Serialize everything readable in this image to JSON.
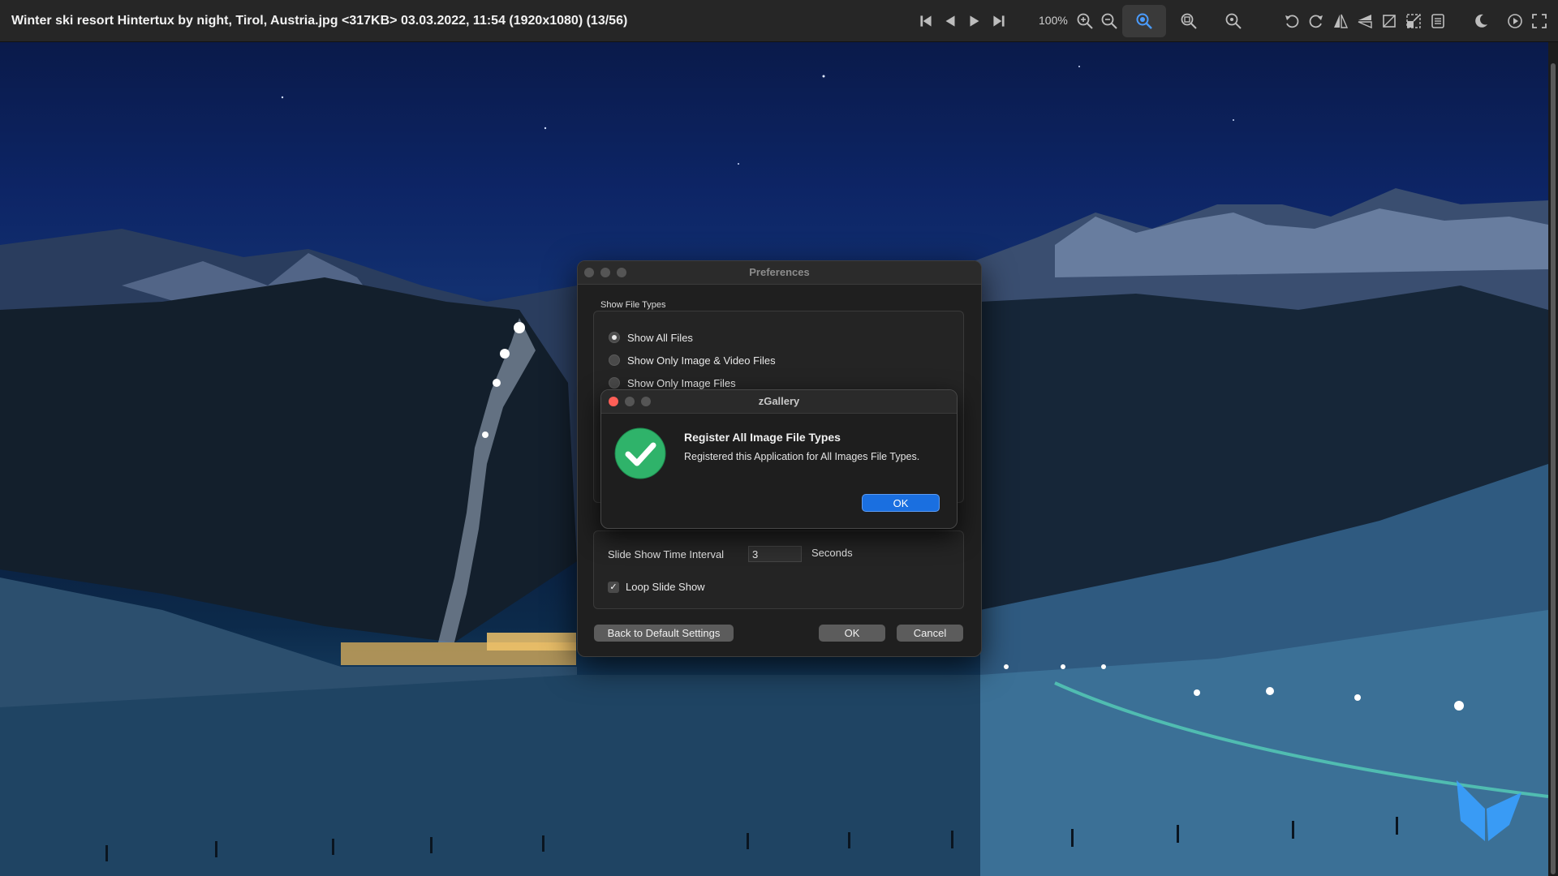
{
  "window": {
    "title": "Winter ski resort Hintertux by night, Tirol, Austria.jpg <317KB> 03.03.2022, 11:54 (1920x1080) (13/56)"
  },
  "toolbar": {
    "zoom_level": "100%",
    "icons": [
      "first-icon",
      "previous-icon",
      "play-icon",
      "last-icon",
      "zoom-in-icon",
      "zoom-out-icon",
      "zoom-fit-icon",
      "zoom-actual-icon",
      "zoom-custom-icon",
      "rotate-left-icon",
      "rotate-right-icon",
      "flip-horizontal-icon",
      "flip-vertical-icon",
      "crop-icon",
      "resize-icon",
      "info-icon",
      "dark-mode-icon",
      "slideshow-icon",
      "fullscreen-icon"
    ]
  },
  "preferences": {
    "title": "Preferences",
    "file_types_label": "Show File Types",
    "options": [
      {
        "label": "Show All Files",
        "selected": true
      },
      {
        "label": "Show Only Image & Video Files",
        "selected": false
      },
      {
        "label": "Show Only Image Files",
        "selected": false
      }
    ],
    "slideshow": {
      "interval_label": "Slide Show Time Interval",
      "interval_value": "3",
      "seconds_label": "Seconds",
      "loop_label": "Loop Slide Show",
      "loop_checked": true
    },
    "buttons": {
      "defaults": "Back to Default Settings",
      "ok": "OK",
      "cancel": "Cancel"
    }
  },
  "alert": {
    "title": "zGallery",
    "heading": "Register All Image File Types",
    "message": "Registered this Application for All Images File Types.",
    "ok": "OK",
    "icon": "success-check-icon",
    "icon_color": "#2fb36a",
    "accent_color": "#1a6fe0"
  }
}
